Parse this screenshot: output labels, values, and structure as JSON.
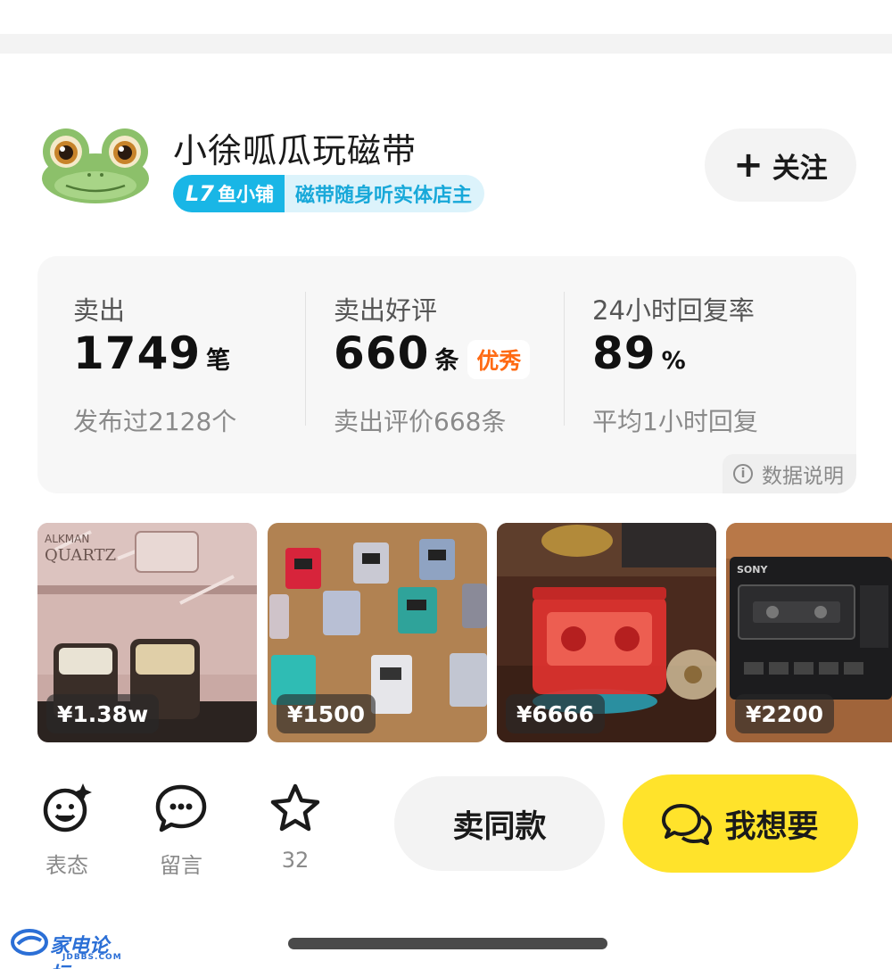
{
  "seller": {
    "name": "小徐呱瓜玩磁带",
    "level": "L7",
    "shop_type": "鱼小铺",
    "description": "磁带随身听实体店主",
    "follow_label": "关注"
  },
  "stats": {
    "sold": {
      "label": "卖出",
      "value": "1749",
      "unit": "笔",
      "sub": "发布过2128个"
    },
    "good_reviews": {
      "label": "卖出好评",
      "value": "660",
      "unit": "条",
      "tag": "优秀",
      "sub": "卖出评价668条"
    },
    "reply_rate": {
      "label": "24小时回复率",
      "value": "89",
      "unit": "%",
      "sub": "平均1小时回复"
    },
    "data_note": "数据说明"
  },
  "products": [
    {
      "price": "¥1.38w",
      "theme": "walkman-boxes"
    },
    {
      "price": "¥1500",
      "theme": "walkman-collection"
    },
    {
      "price": "¥6666",
      "theme": "red-cassette-player"
    },
    {
      "price": "¥2200",
      "theme": "sony-cassette-recorder"
    }
  ],
  "actions": {
    "react_label": "表态",
    "comment_label": "留言",
    "favorite_count": "32",
    "sell_same_label": "卖同款",
    "want_label": "我想要"
  },
  "watermark": {
    "text": "家电论坛",
    "sub": "JDBBS.COM"
  },
  "colors": {
    "accent_yellow": "#ffe32b",
    "level_blue": "#19b6e6",
    "excellent_orange": "#ff6a13"
  }
}
